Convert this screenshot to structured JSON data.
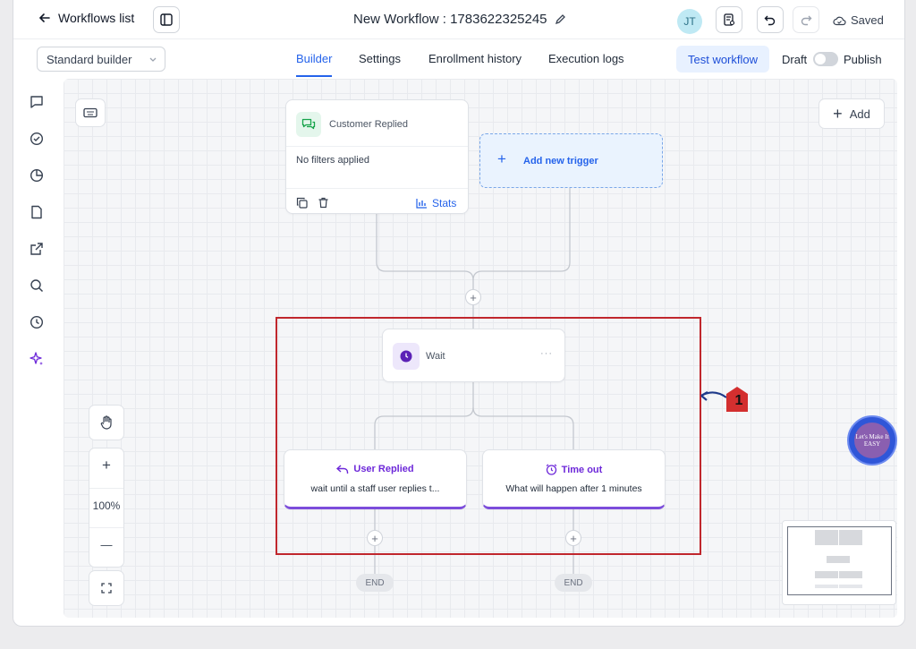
{
  "header": {
    "back_label": "Workflows list",
    "workflow_title": "New Workflow : 1783622325245",
    "avatar_initials": "JT",
    "saved_label": "Saved"
  },
  "subbar": {
    "builder_select": "Standard builder",
    "tabs": [
      {
        "label": "Builder",
        "active": true
      },
      {
        "label": "Settings"
      },
      {
        "label": "Enrollment history"
      },
      {
        "label": "Execution logs"
      }
    ],
    "test_button": "Test workflow",
    "draft_label": "Draft",
    "publish_label": "Publish"
  },
  "rail_icons": [
    "chat-icon",
    "check-circle-icon",
    "pie-chart-icon",
    "file-icon",
    "external-link-icon",
    "search-icon",
    "history-icon",
    "sparkle-icon"
  ],
  "canvas": {
    "add_label": "Add",
    "trigger": {
      "name": "Customer Replied",
      "filters": "No filters applied",
      "stats_label": "Stats"
    },
    "add_trigger_label": "Add new trigger",
    "wait": {
      "label": "Wait",
      "menu": "···"
    },
    "branches": [
      {
        "title": "User Replied",
        "desc": "wait until a staff user replies t..."
      },
      {
        "title": "Time out",
        "desc": "What will happen after 1 minutes"
      }
    ],
    "end_label": "END",
    "zoom": {
      "plus": "+",
      "level": "100%",
      "minus": "—"
    },
    "annotation_number": "1",
    "watermark": "Let's Make It EASY"
  },
  "colors": {
    "accent": "#2563eb",
    "purple": "#7c4ddb",
    "annotation": "#c0272d"
  }
}
